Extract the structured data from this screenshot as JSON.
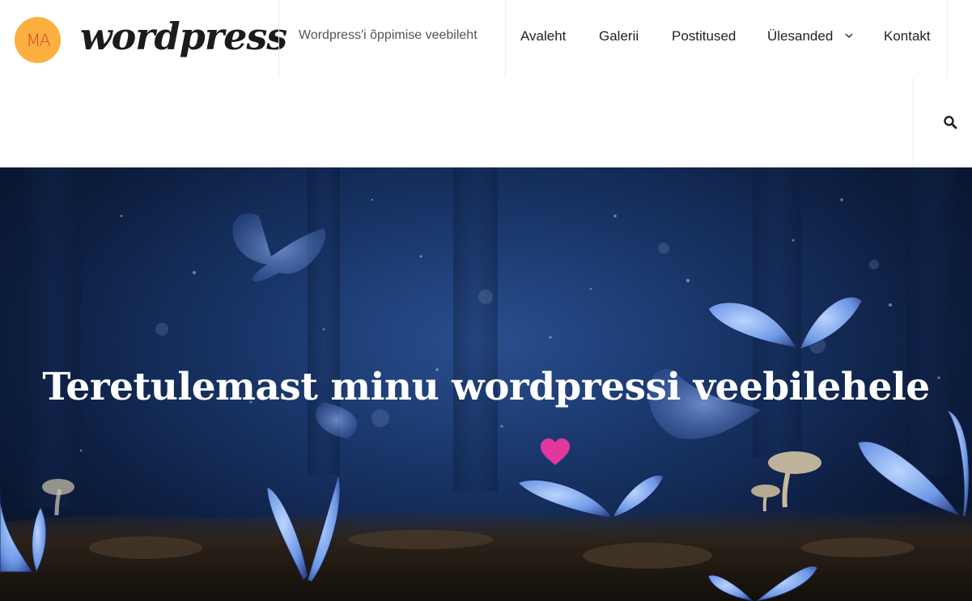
{
  "header": {
    "logo_text": "MA",
    "site_title": "wordpress",
    "tagline": "Wordpress'i õppimise veebileht",
    "nav": [
      {
        "label": "Avaleht"
      },
      {
        "label": "Galerii"
      },
      {
        "label": "Postitused"
      },
      {
        "label": "Ülesanded",
        "has_submenu": true
      },
      {
        "label": "Kontakt"
      }
    ],
    "search_icon": "search-icon",
    "submenu_icon": "chevron-down-icon"
  },
  "hero": {
    "title": "Teretulemast minu wordpressi veebilehele",
    "heart_icon": "heart-icon",
    "heart_color": "#e0389c"
  },
  "colors": {
    "logo_bg": "#fbb040",
    "logo_text": "#e0442b"
  }
}
